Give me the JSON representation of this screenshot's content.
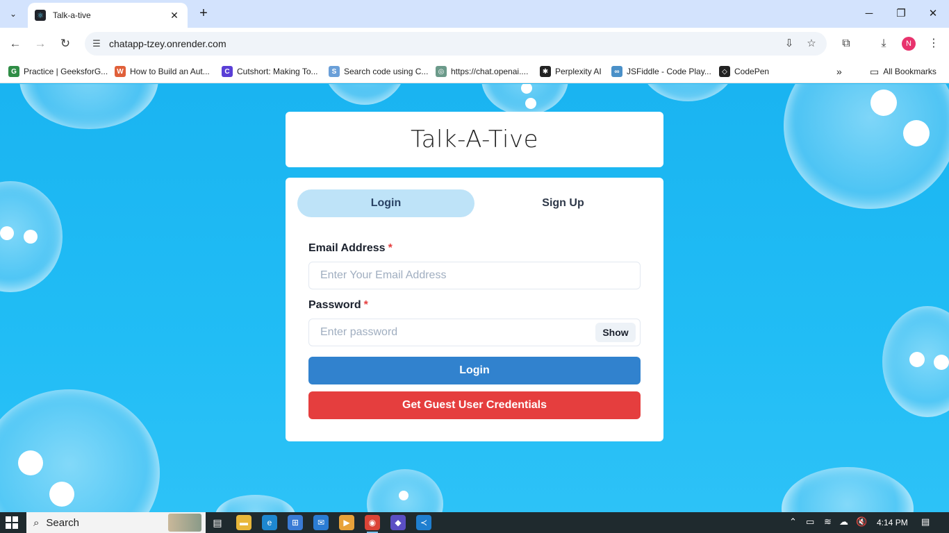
{
  "browser": {
    "tab_title": "Talk-a-tive",
    "url": "chatapp-tzey.onrender.com",
    "new_tab": "+",
    "bookmarks": [
      {
        "label": "Practice | GeeksforG...",
        "icon": "geeksforgeeks-icon",
        "color": "#2f8d46"
      },
      {
        "label": "How to Build an Aut...",
        "icon": "bookmark-site-icon",
        "color": "#e0603a"
      },
      {
        "label": "Cutshort: Making To...",
        "icon": "cutshort-icon",
        "color": "#5a3fd6"
      },
      {
        "label": "Search code using C...",
        "icon": "code-search-icon",
        "color": "#6a9fd8"
      },
      {
        "label": "https://chat.openai....",
        "icon": "openai-icon",
        "color": "#6b9a8a"
      },
      {
        "label": "Perplexity AI",
        "icon": "perplexity-icon",
        "color": "#222222"
      },
      {
        "label": "JSFiddle - Code Play...",
        "icon": "jsfiddle-icon",
        "color": "#4a90c8"
      },
      {
        "label": "CodePen",
        "icon": "codepen-icon",
        "color": "#222222"
      }
    ],
    "all_bookmarks": "All Bookmarks",
    "profile_initial": "N"
  },
  "app": {
    "brand": "Talk-A-Tive",
    "tabs": [
      "Login",
      "Sign Up"
    ],
    "email_label": "Email Address",
    "email_placeholder": "Enter Your Email Address",
    "password_label": "Password",
    "password_placeholder": "Enter password",
    "required_mark": "*",
    "show_label": "Show",
    "login_button": "Login",
    "guest_button": "Get Guest User Credentials"
  },
  "taskbar": {
    "search_label": "Search",
    "time": "4:14 PM"
  },
  "colors": {
    "primary": "#3182ce",
    "danger": "#e53e3e",
    "active_tab": "#bee3f8",
    "page_bg": "#1fb8f3"
  }
}
